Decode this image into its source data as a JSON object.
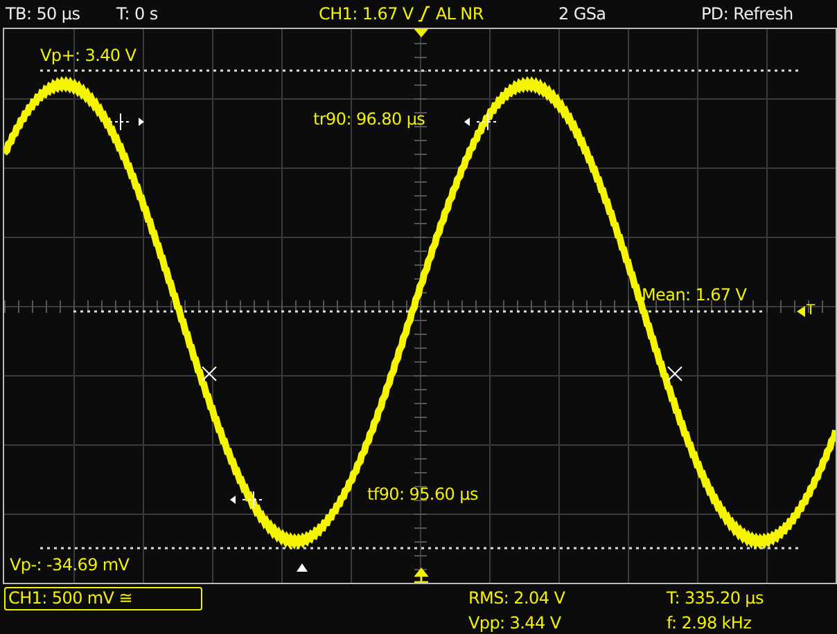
{
  "top_bar": {
    "timebase": "TB: 50 µs",
    "trigger_time": "T: 0 s",
    "channel_level": "CH1: 1.67 V",
    "trigger_mode": "AL NR",
    "sample_rate": "2 GSa",
    "display_mode": "PD: Refresh"
  },
  "plot": {
    "trigger_level_label": "T",
    "measurements": [
      {
        "kind": "vp_plus",
        "text": "Vp+: 3.40 V"
      },
      {
        "kind": "tr90",
        "text": "tr90: 96.80 µs"
      },
      {
        "kind": "mean",
        "text": "Mean: 1.67 V"
      },
      {
        "kind": "tf90",
        "text": "tf90: 95.60 µs"
      },
      {
        "kind": "vp_minus",
        "text": "Vp-: -34.69 mV"
      }
    ]
  },
  "bottom_bar": {
    "channel_scale": "CH1: 500 mV ≅",
    "readouts": [
      {
        "text": "RMS: 2.04 V"
      },
      {
        "text": "T: 335.20 µs"
      },
      {
        "text": "Vpp: 3.44 V"
      },
      {
        "text": "f: 2.98 kHz"
      }
    ]
  }
}
